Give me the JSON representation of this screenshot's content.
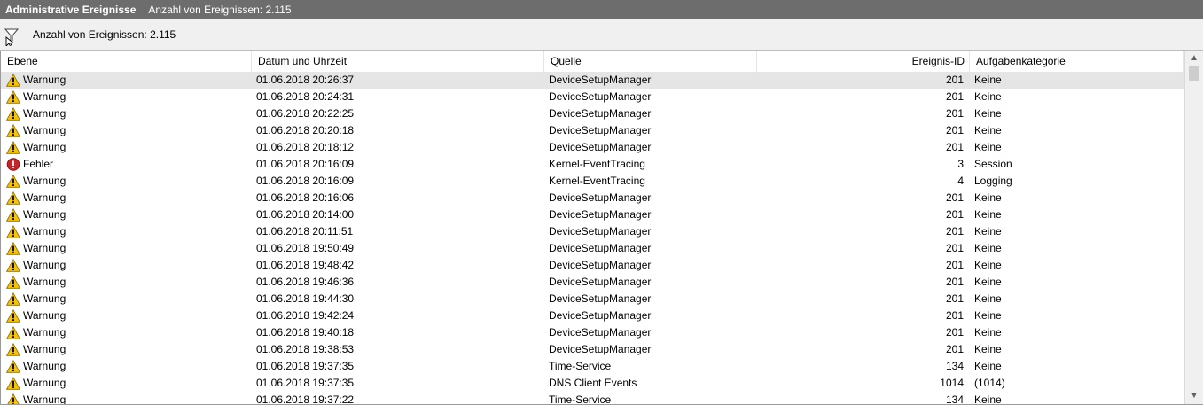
{
  "title_bar": {
    "title": "Administrative Ereignisse",
    "count_text": "Anzahl von Ereignissen: 2.115"
  },
  "filter_bar": {
    "icon": "filter-funnel-icon",
    "text": "Anzahl von Ereignissen: 2.115"
  },
  "columns": [
    "Ebene",
    "Datum und Uhrzeit",
    "Quelle",
    "Ereignis-ID",
    "Aufgabenkategorie"
  ],
  "level_icons": {
    "Warnung": "warning-triangle-icon",
    "Fehler": "error-circle-icon"
  },
  "colors": {
    "warning_fill": "#f5c30b",
    "error_fill": "#c5242b",
    "title_bar_bg": "#6d6d6d",
    "selected_row_bg": "#e5e5e5"
  },
  "events": [
    {
      "level": "Warnung",
      "datetime": "01.06.2018 20:26:37",
      "source": "DeviceSetupManager",
      "id": "201",
      "category": "Keine"
    },
    {
      "level": "Warnung",
      "datetime": "01.06.2018 20:24:31",
      "source": "DeviceSetupManager",
      "id": "201",
      "category": "Keine"
    },
    {
      "level": "Warnung",
      "datetime": "01.06.2018 20:22:25",
      "source": "DeviceSetupManager",
      "id": "201",
      "category": "Keine"
    },
    {
      "level": "Warnung",
      "datetime": "01.06.2018 20:20:18",
      "source": "DeviceSetupManager",
      "id": "201",
      "category": "Keine"
    },
    {
      "level": "Warnung",
      "datetime": "01.06.2018 20:18:12",
      "source": "DeviceSetupManager",
      "id": "201",
      "category": "Keine"
    },
    {
      "level": "Fehler",
      "datetime": "01.06.2018 20:16:09",
      "source": "Kernel-EventTracing",
      "id": "3",
      "category": "Session"
    },
    {
      "level": "Warnung",
      "datetime": "01.06.2018 20:16:09",
      "source": "Kernel-EventTracing",
      "id": "4",
      "category": "Logging"
    },
    {
      "level": "Warnung",
      "datetime": "01.06.2018 20:16:06",
      "source": "DeviceSetupManager",
      "id": "201",
      "category": "Keine"
    },
    {
      "level": "Warnung",
      "datetime": "01.06.2018 20:14:00",
      "source": "DeviceSetupManager",
      "id": "201",
      "category": "Keine"
    },
    {
      "level": "Warnung",
      "datetime": "01.06.2018 20:11:51",
      "source": "DeviceSetupManager",
      "id": "201",
      "category": "Keine"
    },
    {
      "level": "Warnung",
      "datetime": "01.06.2018 19:50:49",
      "source": "DeviceSetupManager",
      "id": "201",
      "category": "Keine"
    },
    {
      "level": "Warnung",
      "datetime": "01.06.2018 19:48:42",
      "source": "DeviceSetupManager",
      "id": "201",
      "category": "Keine"
    },
    {
      "level": "Warnung",
      "datetime": "01.06.2018 19:46:36",
      "source": "DeviceSetupManager",
      "id": "201",
      "category": "Keine"
    },
    {
      "level": "Warnung",
      "datetime": "01.06.2018 19:44:30",
      "source": "DeviceSetupManager",
      "id": "201",
      "category": "Keine"
    },
    {
      "level": "Warnung",
      "datetime": "01.06.2018 19:42:24",
      "source": "DeviceSetupManager",
      "id": "201",
      "category": "Keine"
    },
    {
      "level": "Warnung",
      "datetime": "01.06.2018 19:40:18",
      "source": "DeviceSetupManager",
      "id": "201",
      "category": "Keine"
    },
    {
      "level": "Warnung",
      "datetime": "01.06.2018 19:38:53",
      "source": "DeviceSetupManager",
      "id": "201",
      "category": "Keine"
    },
    {
      "level": "Warnung",
      "datetime": "01.06.2018 19:37:35",
      "source": "Time-Service",
      "id": "134",
      "category": "Keine"
    },
    {
      "level": "Warnung",
      "datetime": "01.06.2018 19:37:35",
      "source": "DNS Client Events",
      "id": "1014",
      "category": "(1014)"
    },
    {
      "level": "Warnung",
      "datetime": "01.06.2018 19:37:22",
      "source": "Time-Service",
      "id": "134",
      "category": "Keine"
    }
  ],
  "scrollbar": {
    "up_icon": "scroll-up-arrow-icon",
    "down_icon": "scroll-down-arrow-icon",
    "position": 0.0
  }
}
